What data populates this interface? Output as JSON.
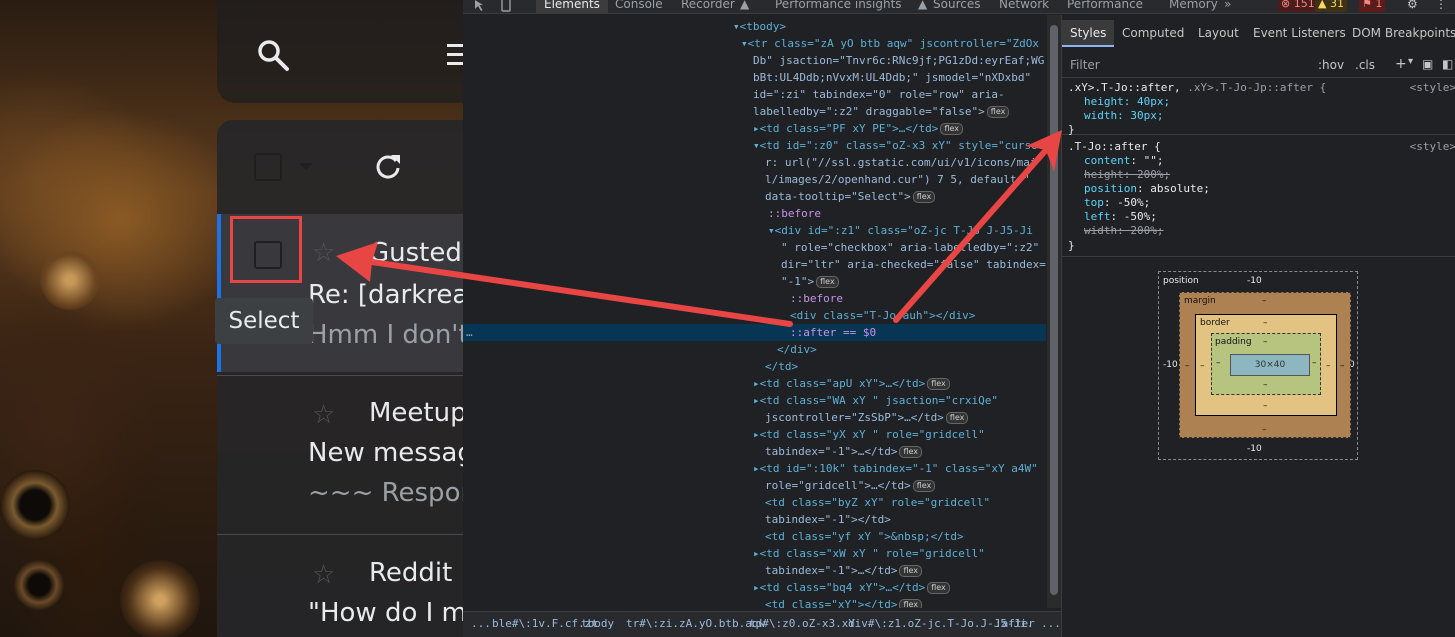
{
  "gmail": {
    "tooltip": "Select",
    "emails": [
      {
        "sender": "Gusted",
        "subject": "Re: [darkrea",
        "snippet": "Hmm I don't"
      },
      {
        "sender": "Meetup",
        "subject": "New messag",
        "snippet": "~~~ Respond"
      },
      {
        "sender": "Reddit",
        "subject": "\"How do I m",
        "snippet": ""
      }
    ]
  },
  "devtools": {
    "tabs": [
      "Elements",
      "Console",
      "Recorder",
      "Performance insights",
      "Sources",
      "Network",
      "Performance",
      "Memory",
      "»"
    ],
    "errors": "151",
    "warnings": "31",
    "issues": "1",
    "dom_lines": [
      {
        "t": "▾<tbody>"
      },
      {
        "t": "▾<tr class=\"zA yO btb aqw\" jscontroller=\"ZdOx"
      },
      {
        "t": "Db\" jsaction=\"Tnvr6c:RNc9jf;PG1zDd:eyrEaf;WG"
      },
      {
        "t": "bBt:UL4Ddb;nVvxM:UL4Ddb;\" jsmodel=\"nXDxbd\""
      },
      {
        "t": "id=\":zi\" tabindex=\"0\" role=\"row\" aria-"
      },
      {
        "t": "labelledby=\":z2\" draggable=\"false\">",
        "flex": true
      },
      {
        "t": "▸<td class=\"PF xY PE\">…</td>",
        "flex": true
      },
      {
        "t": "▾<td id=\":z0\" class=\"oZ-x3 xY\" style=\"curso"
      },
      {
        "t": "r: url(\"//ssl.gstatic.com/ui/v1/icons/mai"
      },
      {
        "t": "l/images/2/openhand.cur\") 7 5, default;\""
      },
      {
        "t": "data-tooltip=\"Select\">",
        "flex": true
      },
      {
        "t": "::before"
      },
      {
        "t": "▾<div id=\":z1\" class=\"oZ-jc T-Jo J-J5-Ji"
      },
      {
        "t": "\" role=\"checkbox\" aria-labelledby=\":z2\""
      },
      {
        "t": "dir=\"ltr\" aria-checked=\"false\" tabindex="
      },
      {
        "t": "\"-1\">",
        "flex": true
      },
      {
        "t": "::before"
      },
      {
        "t": "<div class=\"T-Jo-auh\"></div>"
      },
      {
        "t": "::after == $0"
      },
      {
        "t": "</div>"
      },
      {
        "t": "</td>"
      },
      {
        "t": "▸<td class=\"apU xY\">…</td>",
        "flex": true
      },
      {
        "t": "▸<td class=\"WA xY \" jsaction=\"crxiQe\""
      },
      {
        "t": "jscontroller=\"ZsSbP\">…</td>",
        "flex": true
      },
      {
        "t": "▸<td class=\"yX xY \" role=\"gridcell\""
      },
      {
        "t": "tabindex=\"-1\">…</td>",
        "flex": true
      },
      {
        "t": "▸<td id=\":10k\" tabindex=\"-1\" class=\"xY a4W\""
      },
      {
        "t": "role=\"gridcell\">…</td>",
        "flex": true
      },
      {
        "t": "<td class=\"byZ xY\" role=\"gridcell\""
      },
      {
        "t": "tabindex=\"-1\"></td>"
      },
      {
        "t": "<td class=\"yf xY \">&nbsp;</td>"
      },
      {
        "t": "▸<td class=\"xW xY \" role=\"gridcell\""
      },
      {
        "t": "tabindex=\"-1\">…</td>",
        "flex": true
      },
      {
        "t": "▸<td class=\"bq4 xY\">…</td>",
        "flex": true
      },
      {
        "t": "<td class=\"xY\"></td>",
        "flex": true
      }
    ],
    "flex_label": "flex",
    "crumbs": [
      "...",
      "ble#\\:1v.F.cf.zt",
      "tbody",
      "tr#\\:zi.zA.yO.btb.aqw",
      "td#\\:z0.oZ-x3.xY",
      "div#\\:z1.oZ-jc.T-Jo.J-J5-Ji.",
      ":after",
      "..."
    ],
    "styles_tabs": [
      "Styles",
      "Computed",
      "Layout",
      "Event Listeners",
      "DOM Breakpoints"
    ],
    "filter_placeholder": "Filter",
    "filter_hov": ":hov",
    "filter_cls": ".cls",
    "rule1": {
      "selector": ".xY>.T-Jo::after, ",
      "selector_dim": ".xY>.T-Jo-Jp::after {",
      "source": "<style>",
      "lines": [
        "height: 40px;",
        "width: 30px;"
      ],
      "close": "}"
    },
    "rule2": {
      "selector": ".T-Jo::after {",
      "source": "<style>",
      "lines": [
        {
          "p": "content",
          "v": " \"\";",
          "struck": false
        },
        {
          "p": "height",
          "v": ": 200%;",
          "struck": true
        },
        {
          "p": "position",
          "v": ": absolute;",
          "struck": false
        },
        {
          "p": "top",
          "v": ": -50%;",
          "struck": false
        },
        {
          "p": "left",
          "v": ": -50%;",
          "struck": false
        },
        {
          "p": "width",
          "v": ": 200%;",
          "struck": true
        }
      ],
      "close": "}"
    },
    "boxmodel": {
      "position": "position",
      "position_top": "-10",
      "position_bottom": "-10",
      "position_left": "-10",
      "position_right": "0",
      "margin": "margin",
      "border": "border",
      "padding": "padding",
      "dash": "–",
      "content": "30×40"
    }
  },
  "colors": {
    "accent_red": "#e84545",
    "gmail_blue": "#1a73e8"
  }
}
